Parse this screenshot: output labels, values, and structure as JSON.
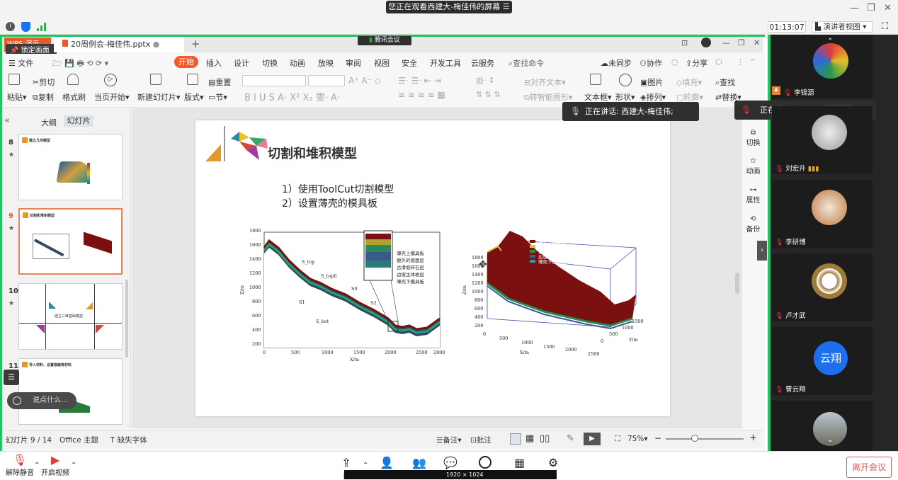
{
  "meeting": {
    "share_banner": "您正在观看西建大-梅佳伟的屏幕",
    "timer": "01:13:07",
    "presenter_view_label": "演讲者视图",
    "share_tag": "腾讯会议",
    "speaking_label": "正在讲话: 西建大-梅佳伟;",
    "speaking_label2": "正在讲话:",
    "participants": [
      {
        "name": "李锦源",
        "type": "image"
      },
      {
        "name": "刘宏升",
        "type": "image"
      },
      {
        "name": "李研博",
        "type": "image"
      },
      {
        "name": "卢才武",
        "type": "image"
      },
      {
        "name": "曹云翔",
        "type": "avatar",
        "avatar_text": "云翔",
        "avatar_color": "#1e6ff0"
      },
      {
        "name": "",
        "type": "image"
      }
    ],
    "bottom": {
      "mute": "解除静音",
      "video": "开启视频",
      "leave": "离开会议",
      "share_partial": "共",
      "settings_partial": "置",
      "resolution": "1920 × 1024"
    }
  },
  "wps": {
    "app_tab": "WPS 演示",
    "lock_screen": "锁定画面",
    "doc_tab": "20周例会-梅佳伟.pptx",
    "menu": [
      "文件",
      "开始",
      "插入",
      "设计",
      "切换",
      "动画",
      "放映",
      "审阅",
      "视图",
      "安全",
      "开发工具",
      "云服务"
    ],
    "search": "查找命令",
    "sync": "未同步",
    "collab": "协作",
    "share": "分享",
    "ribbon": {
      "paste": "粘贴",
      "cut": "剪切",
      "copy": "复制",
      "format_painter": "格式刷",
      "play": "当页开始",
      "new_slide": "新建幻灯片",
      "layout": "版式",
      "section": "节",
      "reset": "重置",
      "textbox": "文本框",
      "shape": "形状",
      "picture": "图片",
      "arrange": "排列",
      "fill": "填充",
      "outline": "轮廓",
      "find": "查找",
      "replace": "替换",
      "align_text": "对齐文本",
      "smart_graphic": "转智能图形"
    },
    "panel_tabs": [
      "大纲",
      "幻灯片"
    ],
    "thumb_numbers": [
      "8",
      "9",
      "10",
      "11"
    ],
    "thumb_titles": [
      "建立几何模型",
      "切割和堆积模型",
      "建立三维基础模型",
      "导入材料、设置接触等材料"
    ],
    "side_tools": [
      "切换",
      "动画",
      "属性",
      "备份"
    ],
    "status": {
      "slide_index": "幻灯片 9 / 14",
      "theme": "Office 主题",
      "missing_font": "缺失字体",
      "notes": "备注",
      "comment": "批注",
      "zoom": "75%"
    },
    "comment_placeholder": "说点什么..."
  },
  "slide": {
    "title": "切割和堆积模型",
    "bullets": [
      "1）使用ToolCut切割模型",
      "2）设置薄壳的模具板"
    ],
    "left_plot": {
      "ylabel": "Z/m",
      "xlabel": "X/m",
      "yticks": [
        "1800",
        "1600",
        "1400",
        "1200",
        "1000",
        "800",
        "600",
        "400",
        "200"
      ],
      "xticks": [
        "0",
        "500",
        "1000",
        "1500",
        "2000",
        "2500",
        "2800"
      ],
      "annotations": [
        "S_top",
        "S_top0",
        "S0",
        "S1",
        "S2",
        "S_bot"
      ],
      "legend": [
        "薄壳上模具板",
        "额外的坡面层",
        "古滑坡碎石层",
        "边坡主体岩层",
        "薄壳下模具板"
      ]
    },
    "right_plot": {
      "zlabel": "Z/m",
      "xlabel": "X/m",
      "ylabel": "Y/m",
      "zticks": [
        "1800",
        "1600",
        "1400",
        "1200",
        "1000",
        "800",
        "600",
        "400",
        "200"
      ],
      "xticks": [
        "0",
        "500",
        "1000",
        "1500",
        "2000",
        "2500"
      ],
      "yticks": [
        "0",
        "500",
        "1000",
        "1500"
      ],
      "legend": [
        {
          "label": "薄壳上模具板",
          "color": "#7a1010"
        },
        {
          "label": "额外的坡面层",
          "color": "#d8c832"
        },
        {
          "label": "古滑坡碎石层",
          "color": "#2a8a4a"
        },
        {
          "label": "边坡主体岩层",
          "color": "#3a5aa0"
        },
        {
          "label": "薄壳下模具板",
          "color": "#2aa0a0"
        }
      ]
    }
  }
}
